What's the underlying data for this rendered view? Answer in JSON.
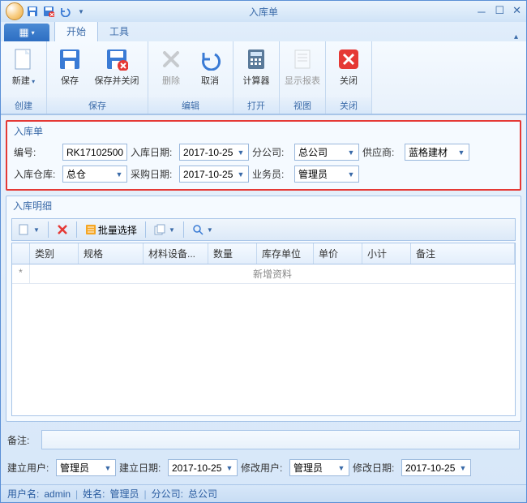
{
  "window": {
    "title": "入库单"
  },
  "tabs": {
    "start": "开始",
    "tools": "工具"
  },
  "ribbon": {
    "new": "新建",
    "save": "保存",
    "save_close": "保存并关闭",
    "delete": "删除",
    "cancel": "取消",
    "calculator": "计算器",
    "show_report": "显示报表",
    "close": "关闭",
    "grp_create": "创建",
    "grp_save": "保存",
    "grp_edit": "编辑",
    "grp_open": "打开",
    "grp_view": "视图",
    "grp_close": "关闭"
  },
  "form": {
    "section_title": "入库单",
    "code_label": "编号:",
    "code_value": "RK17102500",
    "indate_label": "入库日期:",
    "indate_value": "2017-10-25",
    "branch_label": "分公司:",
    "branch_value": "总公司",
    "supplier_label": "供应商:",
    "supplier_value": "蓝格建材",
    "wh_label": "入库仓库:",
    "wh_value": "总仓",
    "purdate_label": "采购日期:",
    "purdate_value": "2017-10-25",
    "clerk_label": "业务员:",
    "clerk_value": "管理员"
  },
  "detail": {
    "section_title": "入库明细",
    "batch_select": "批量选择"
  },
  "grid": {
    "cols": [
      "类别",
      "规格",
      "材料设备...",
      "数量",
      "库存单位",
      "单价",
      "小计",
      "备注"
    ],
    "new_row": "新增资料"
  },
  "remark": {
    "label": "备注:"
  },
  "footer": {
    "create_user_label": "建立用户:",
    "create_user_value": "管理员",
    "create_date_label": "建立日期:",
    "create_date_value": "2017-10-25",
    "mod_user_label": "修改用户:",
    "mod_user_value": "管理员",
    "mod_date_label": "修改日期:",
    "mod_date_value": "2017-10-25"
  },
  "status": {
    "user_label": "用户名:",
    "user_value": "admin",
    "name_label": "姓名:",
    "name_value": "管理员",
    "branch_label": "分公司:",
    "branch_value": "总公司"
  }
}
